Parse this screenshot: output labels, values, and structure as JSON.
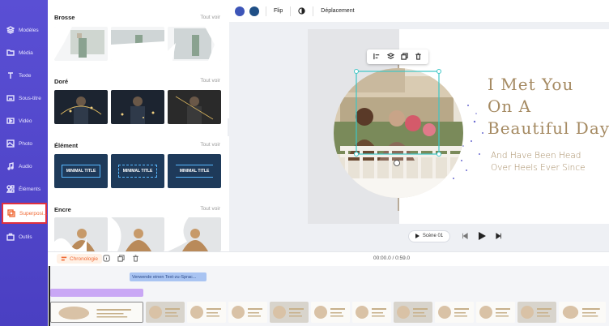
{
  "sidebar": {
    "items": [
      {
        "label": "Modèles",
        "icon": "layers-icon"
      },
      {
        "label": "Média",
        "icon": "folder-icon"
      },
      {
        "label": "Texte",
        "icon": "text-icon"
      },
      {
        "label": "Sous-titre",
        "icon": "subtitle-icon"
      },
      {
        "label": "Vidéo",
        "icon": "video-icon"
      },
      {
        "label": "Photo",
        "icon": "photo-icon"
      },
      {
        "label": "Audio",
        "icon": "music-icon"
      },
      {
        "label": "Éléments",
        "icon": "shapes-icon"
      },
      {
        "label": "Superposi...",
        "icon": "overlay-icon"
      },
      {
        "label": "Outils",
        "icon": "toolbox-icon"
      }
    ],
    "active_index": 8
  },
  "panel": {
    "sections": [
      {
        "title": "Brosse",
        "see_all": "Tout voir"
      },
      {
        "title": "Doré",
        "see_all": "Tout voir"
      },
      {
        "title": "Élément",
        "see_all": "Tout voir"
      },
      {
        "title": "Encre",
        "see_all": "Tout voir"
      }
    ],
    "element_thumb_text": "MINIMAL TITLE"
  },
  "toolbar": {
    "colors": [
      "#3d55b8",
      "#1f4f86"
    ],
    "flip_label": "Flip",
    "move_label": "Déplacement"
  },
  "canvas": {
    "title_lines": [
      "I Met You",
      "On A",
      "Beautiful Day"
    ],
    "subtitle_lines": [
      "And Have Been Head",
      "Over Heels Ever Since"
    ]
  },
  "player": {
    "scene_label": "Scène 01"
  },
  "timeline": {
    "tab_label": "Chronologie",
    "time": "00:00.0 / 0:59.0",
    "tts_label": "Verwende einen Text-zu-Sprac..."
  }
}
